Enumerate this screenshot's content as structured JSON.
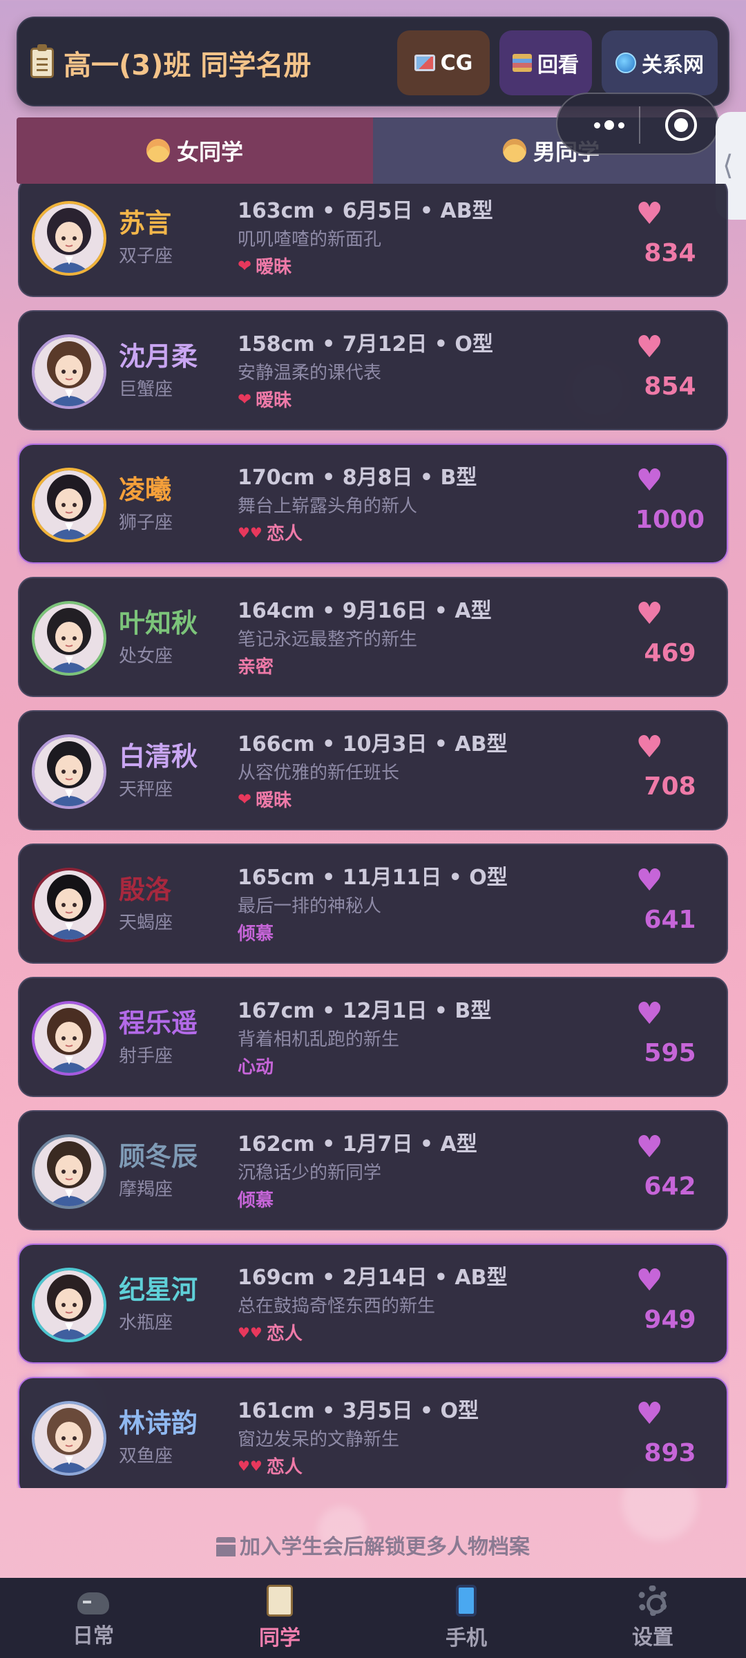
{
  "header": {
    "title": "高一(3)班 同学名册",
    "buttons": [
      {
        "label": "CG",
        "icon": "image-icon"
      },
      {
        "label": "回看",
        "icon": "books-icon"
      },
      {
        "label": "关系网",
        "icon": "globe-icon"
      }
    ]
  },
  "tabs": [
    {
      "label": "女同学",
      "icon": "girl-face-icon",
      "active": true
    },
    {
      "label": "男同学",
      "icon": "boy-face-icon",
      "active": false
    }
  ],
  "students": [
    {
      "name": "苏言",
      "zodiac": "双子座",
      "stats": "163cm • 6月5日 • AB型",
      "bio": "叽叽喳喳的新面孔",
      "relation": "暧昧",
      "relation_icon": "heart-icon",
      "score": "834",
      "name_color": "#f3b64a",
      "ring_color": "#f0b33a",
      "accent": "#ef7aa8",
      "relation_color": "#ef7aa8",
      "hair": "#2a2230"
    },
    {
      "name": "沈月柔",
      "zodiac": "巨蟹座",
      "stats": "158cm • 7月12日 • O型",
      "bio": "安静温柔的课代表",
      "relation": "暧昧",
      "relation_icon": "heart-icon",
      "score": "854",
      "name_color": "#c9a6f2",
      "ring_color": "#b49ad8",
      "accent": "#ef7aa8",
      "relation_color": "#ef7aa8",
      "hair": "#5a3a2a"
    },
    {
      "name": "凌曦",
      "zodiac": "狮子座",
      "stats": "170cm • 8月8日 • B型",
      "bio": "舞台上崭露头角的新人",
      "relation": "恋人",
      "relation_icon": "two-hearts-icon",
      "score": "1000",
      "name_color": "#f5a03a",
      "ring_color": "#f0b33a",
      "accent": "#c665d8",
      "relation_color": "#ef7aa8",
      "hair": "#1f1a22",
      "lover": true
    },
    {
      "name": "叶知秋",
      "zodiac": "处女座",
      "stats": "164cm • 9月16日 • A型",
      "bio": "笔记永远最整齐的新生",
      "relation": "亲密",
      "relation_icon": "",
      "score": "469",
      "name_color": "#7cc47a",
      "ring_color": "#7cc47a",
      "accent": "#ef7aa8",
      "relation_color": "#ef7aa8",
      "hair": "#221f24"
    },
    {
      "name": "白清秋",
      "zodiac": "天秤座",
      "stats": "166cm • 10月3日 • AB型",
      "bio": "从容优雅的新任班长",
      "relation": "暧昧",
      "relation_icon": "heart-icon",
      "score": "708",
      "name_color": "#c9a6f2",
      "ring_color": "#b49ad8",
      "accent": "#ef7aa8",
      "relation_color": "#ef7aa8",
      "hair": "#1c1a20"
    },
    {
      "name": "殷洛",
      "zodiac": "天蝎座",
      "stats": "165cm • 11月11日 • O型",
      "bio": "最后一排的神秘人",
      "relation": "倾慕",
      "relation_icon": "",
      "score": "641",
      "name_color": "#a8283e",
      "ring_color": "#8a2236",
      "accent": "#c665d8",
      "relation_color": "#c665d8",
      "hair": "#141216"
    },
    {
      "name": "程乐遥",
      "zodiac": "射手座",
      "stats": "167cm • 12月1日 • B型",
      "bio": "背着相机乱跑的新生",
      "relation": "心动",
      "relation_icon": "",
      "score": "595",
      "name_color": "#b36ae8",
      "ring_color": "#a65ae0",
      "accent": "#c665d8",
      "relation_color": "#c665d8",
      "hair": "#4a2e22"
    },
    {
      "name": "顾冬辰",
      "zodiac": "摩羯座",
      "stats": "162cm • 1月7日 • A型",
      "bio": "沉稳话少的新同学",
      "relation": "倾慕",
      "relation_icon": "",
      "score": "642",
      "name_color": "#7f9bb6",
      "ring_color": "#6f86a0",
      "accent": "#c665d8",
      "relation_color": "#c665d8",
      "hair": "#3a2a22"
    },
    {
      "name": "纪星河",
      "zodiac": "水瓶座",
      "stats": "169cm • 2月14日 • AB型",
      "bio": "总在鼓捣奇怪东西的新生",
      "relation": "恋人",
      "relation_icon": "two-hearts-icon",
      "score": "949",
      "name_color": "#5fd0d8",
      "ring_color": "#4ec6d0",
      "accent": "#c665d8",
      "relation_color": "#ef7aa8",
      "hair": "#2a2022",
      "lover": true
    },
    {
      "name": "林诗韵",
      "zodiac": "双鱼座",
      "stats": "161cm • 3月5日 • O型",
      "bio": "窗边发呆的文静新生",
      "relation": "恋人",
      "relation_icon": "two-hearts-icon",
      "score": "893",
      "name_color": "#8fb8f0",
      "ring_color": "#8fa8d8",
      "accent": "#c665d8",
      "relation_color": "#ef7aa8",
      "hair": "#6a4a3a",
      "lover": true
    }
  ],
  "footer_note": "加入学生会后解锁更多人物档案",
  "bottom_nav": [
    {
      "label": "日常",
      "icon": "gamepad-icon",
      "active": false
    },
    {
      "label": "同学",
      "icon": "clipboard-icon",
      "active": true
    },
    {
      "label": "手机",
      "icon": "phone-icon",
      "active": false
    },
    {
      "label": "设置",
      "icon": "gear-icon",
      "active": false
    }
  ]
}
